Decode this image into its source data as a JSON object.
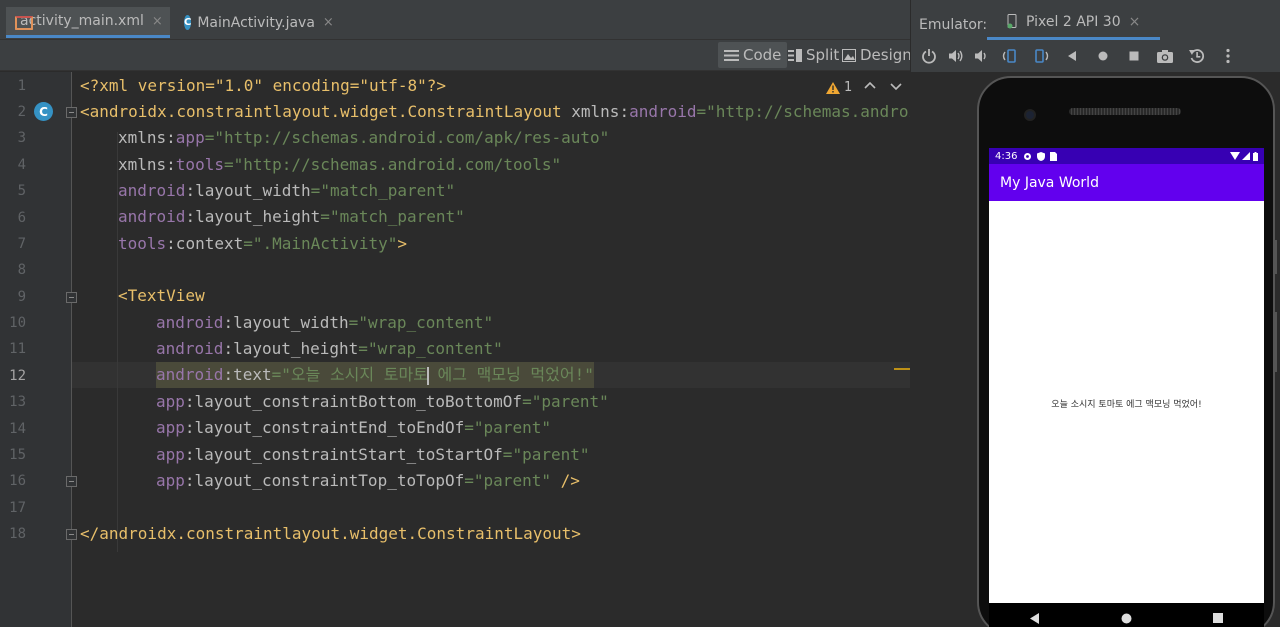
{
  "editor": {
    "tabs": [
      {
        "label": "activity_main.xml",
        "close": "×",
        "icon": "xml-layout-icon",
        "active": true
      },
      {
        "label": "MainActivity.java",
        "close": "×",
        "icon": "java-class-icon",
        "active": false
      }
    ],
    "view_modes": {
      "code": "Code",
      "split": "Split",
      "design": "Design"
    },
    "warning_count": "1",
    "line_numbers": [
      "1",
      "2",
      "3",
      "4",
      "5",
      "6",
      "7",
      "8",
      "9",
      "10",
      "11",
      "12",
      "13",
      "14",
      "15",
      "16",
      "17",
      "18"
    ],
    "current_line": "12",
    "gutter_class_badge": "C",
    "code": {
      "l1": {
        "pi": "<?xml version=\"1.0\" encoding=\"utf-8\"?>"
      },
      "l2": {
        "tag": "<androidx.constraintlayout.widget.ConstraintLayout",
        "attr": " xmlns:",
        "ns": "android",
        "eq": "=",
        "val": "\"http://schemas.android"
      },
      "l3": {
        "attr": "xmlns:",
        "ns": "app",
        "eq": "=",
        "val": "\"http://schemas.android.com/apk/res-auto\""
      },
      "l4": {
        "attr": "xmlns:",
        "ns": "tools",
        "eq": "=",
        "val": "\"http://schemas.android.com/tools\""
      },
      "l5": {
        "ns": "android",
        "attr": ":layout_width",
        "eq": "=",
        "val": "\"match_parent\""
      },
      "l6": {
        "ns": "android",
        "attr": ":layout_height",
        "eq": "=",
        "val": "\"match_parent\""
      },
      "l7": {
        "ns": "tools",
        "attr": ":context",
        "eq": "=",
        "val": "\".MainActivity\"",
        "close": ">"
      },
      "l9": {
        "tag": "<TextView"
      },
      "l10": {
        "ns": "android",
        "attr": ":layout_width",
        "eq": "=",
        "val": "\"wrap_content\""
      },
      "l11": {
        "ns": "android",
        "attr": ":layout_height",
        "eq": "=",
        "val": "\"wrap_content\""
      },
      "l12": {
        "ns": "android",
        "attr": ":text",
        "eq": "=",
        "val_a": "\"오늘 소시지 토마토",
        "val_b": " 에그 맥모닝 먹었어!\""
      },
      "l13": {
        "ns": "app",
        "attr": ":layout_constraintBottom_toBottomOf",
        "eq": "=",
        "val": "\"parent\""
      },
      "l14": {
        "ns": "app",
        "attr": ":layout_constraintEnd_toEndOf",
        "eq": "=",
        "val": "\"parent\""
      },
      "l15": {
        "ns": "app",
        "attr": ":layout_constraintStart_toStartOf",
        "eq": "=",
        "val": "\"parent\""
      },
      "l16": {
        "ns": "app",
        "attr": ":layout_constraintTop_toTopOf",
        "eq": "=",
        "val": "\"parent\"",
        "close": " />"
      },
      "l18": {
        "tag": "</androidx.constraintlayout.widget.ConstraintLayout>"
      }
    }
  },
  "emulator": {
    "label": "Emulator:",
    "device_tab": "Pixel 2 API 30",
    "device_close": "×",
    "tools": [
      "power-icon",
      "volume-up-icon",
      "volume-down-icon",
      "rotate-left-icon",
      "rotate-right-icon",
      "back-icon",
      "home-icon",
      "overview-icon",
      "screenshot-icon",
      "restore-snapshot-icon",
      "more-icon"
    ],
    "phone": {
      "status_time": "4:36",
      "app_title": "My Java World",
      "text_view": "오늘 소시지 토마토 에그 맥모닝 먹었어!"
    }
  },
  "colors": {
    "accent": "#4a88c7",
    "app_bar": "#6200ee",
    "status_bar": "#3700b3",
    "xml_tag": "#e8bf6a",
    "xml_ns": "#9876aa",
    "xml_value": "#6a8759"
  }
}
